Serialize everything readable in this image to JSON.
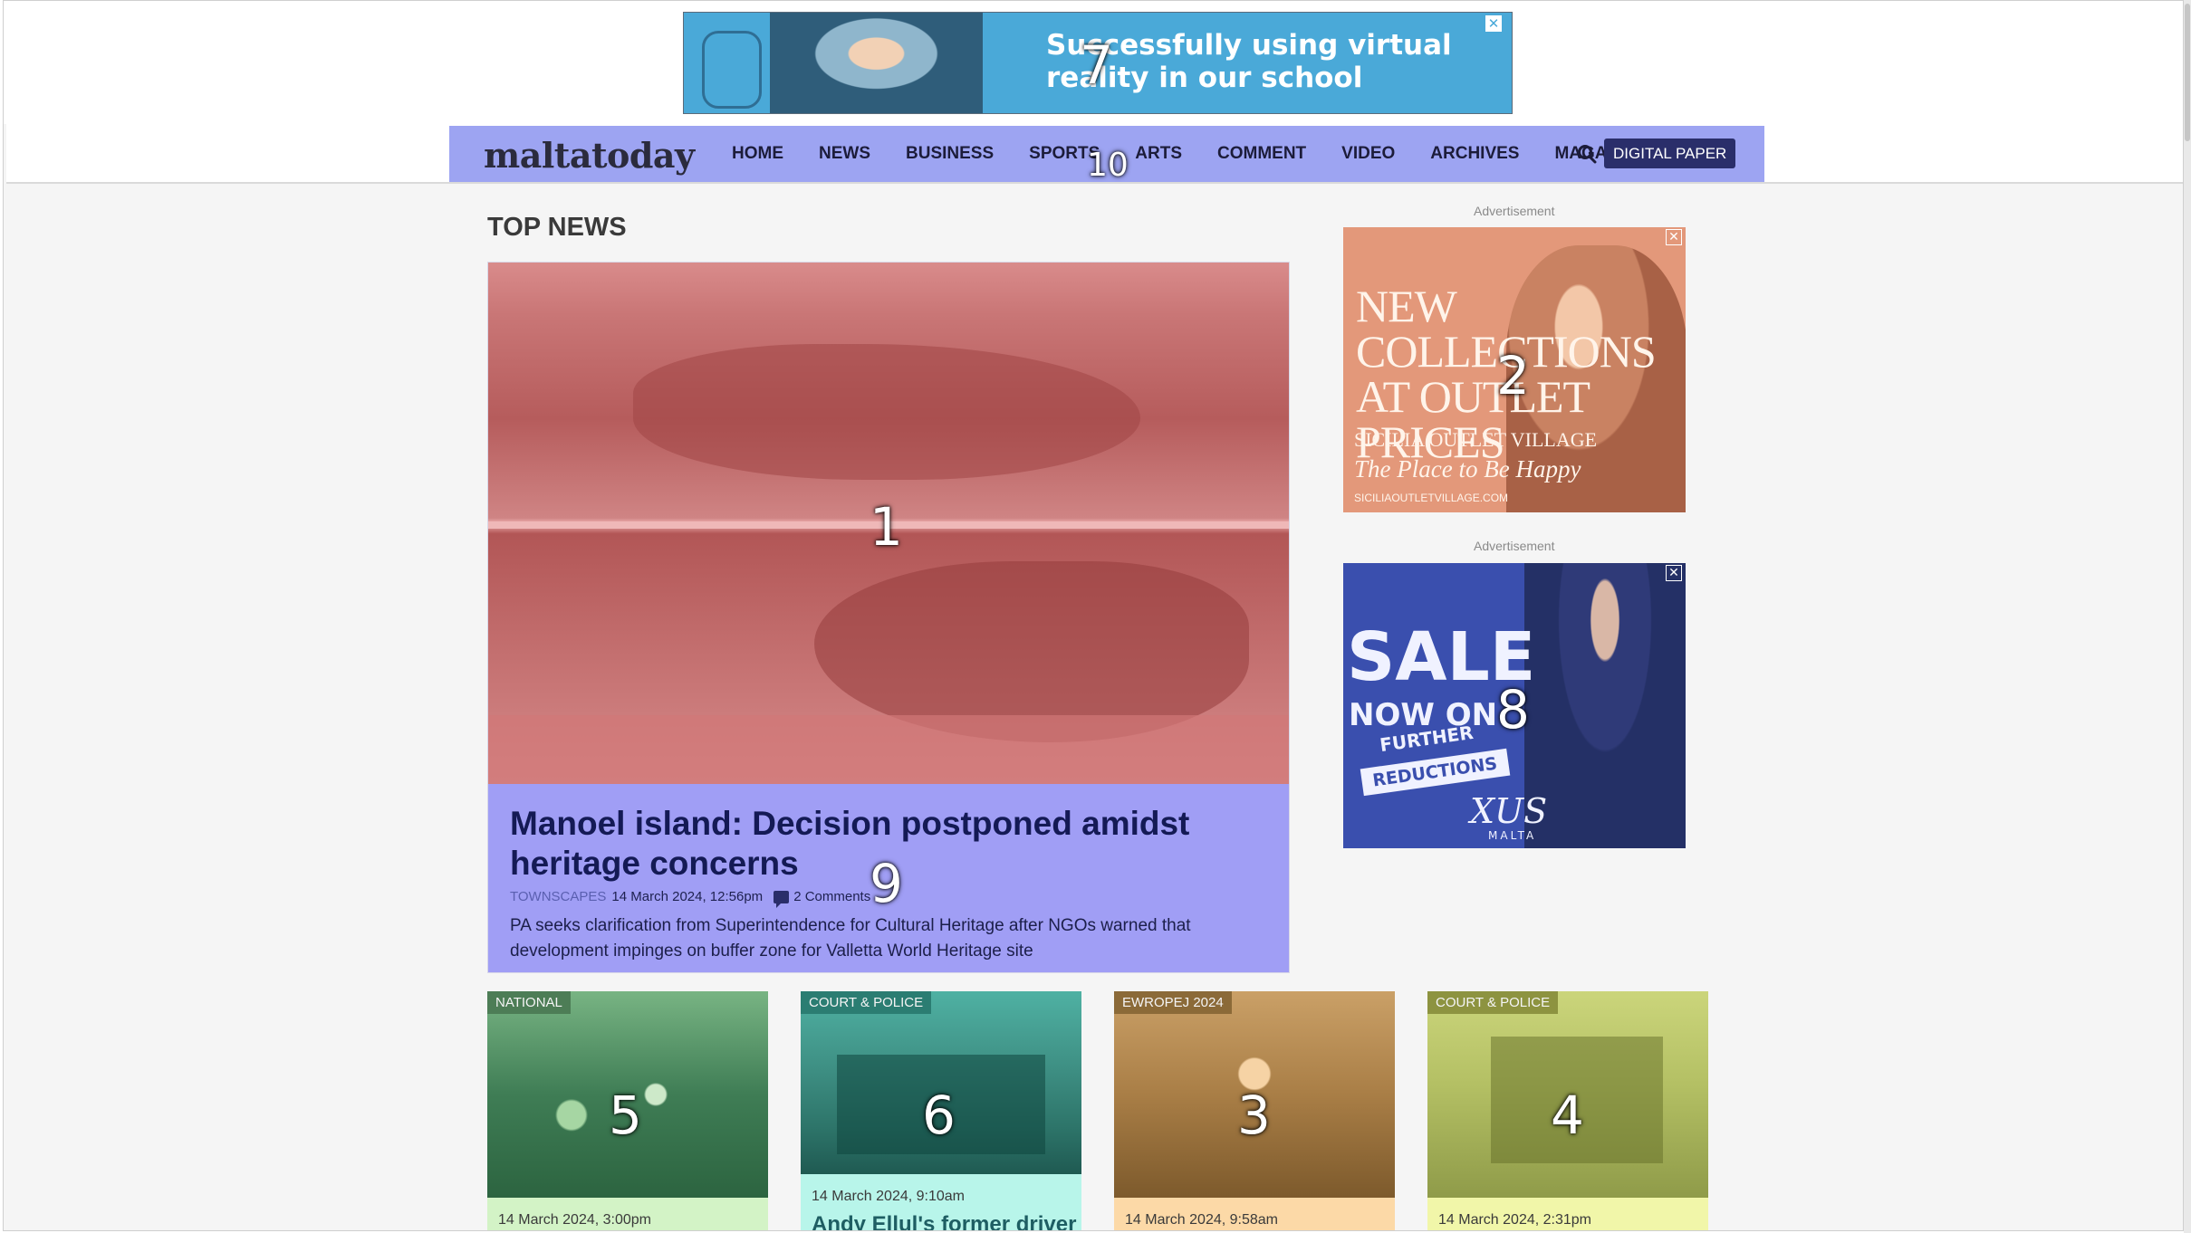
{
  "top_ad": {
    "headline": "Successfully using virtual reality in our school"
  },
  "nav": {
    "logo": "maltatoday",
    "items": [
      "HOME",
      "NEWS",
      "BUSINESS",
      "SPORTS",
      "ARTS",
      "COMMENT",
      "VIDEO",
      "ARCHIVES",
      "MAGAZINES"
    ],
    "digital_paper": "DIGITAL PAPER"
  },
  "main": {
    "section_title": "TOP NEWS",
    "lead": {
      "title": "Manoel island: Decision postponed amidst heritage concerns",
      "category": "TOWNSCAPES",
      "datetime": "14 March 2024, 12:56pm",
      "comments": "2 Comments",
      "summary": "PA seeks clarification from Superintendence for Cultural Heritage after NGOs warned that development impinges on buffer zone for Valletta World Heritage site"
    },
    "cards": [
      {
        "category": "NATIONAL",
        "date": "14 March 2024, 3:00pm",
        "title": ""
      },
      {
        "category": "COURT & POLICE",
        "date": "14 March 2024, 9:10am",
        "title": "Andy Ellul's former driver"
      },
      {
        "category": "EWROPEJ 2024",
        "date": "14 March 2024, 9:58am",
        "title": ""
      },
      {
        "category": "COURT & POLICE",
        "date": "14 March 2024, 2:31pm",
        "title": ""
      }
    ]
  },
  "sidebar": {
    "ad_label": "Advertisement",
    "ad1": {
      "headline": "NEW COLLECTIONS AT OUTLET PRICES",
      "brand": "SICILIA OUTLET VILLAGE",
      "tagline": "The Place to Be Happy",
      "url": "SICILIAOUTLETVILLAGE.COM"
    },
    "ad2": {
      "sale": "SALE",
      "now": "NOW ON",
      "further": "FURTHER",
      "reductions": "REDUCTIONS",
      "brand": "XUS",
      "brand_sub": "MALTA"
    }
  },
  "overlay_marks": [
    "1",
    "2",
    "3",
    "4",
    "5",
    "6",
    "7",
    "8",
    "9",
    "10"
  ]
}
